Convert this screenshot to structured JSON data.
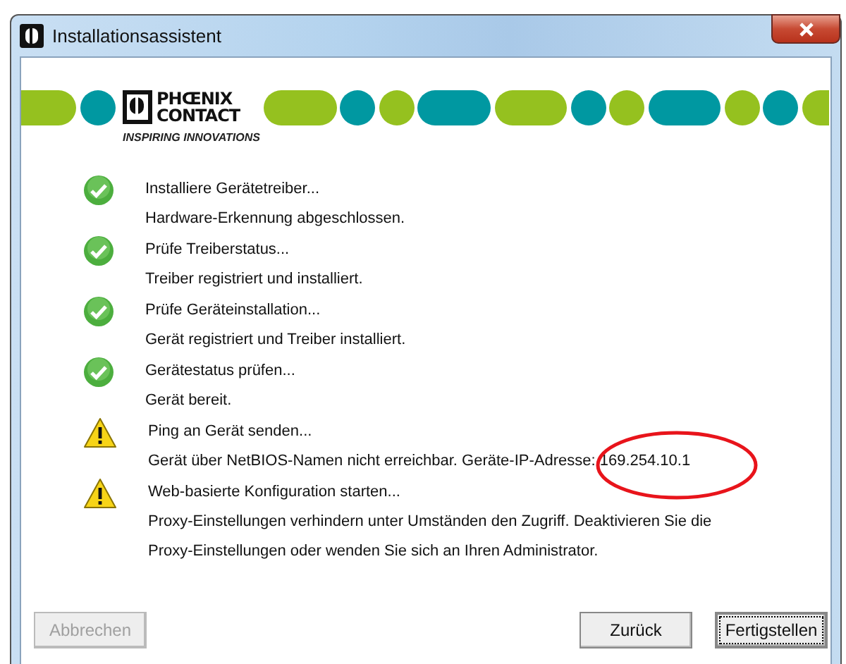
{
  "window": {
    "title": "Installationsassistent"
  },
  "logo": {
    "line_1": "PHŒNIX",
    "line_2": "CONTACT",
    "tagline": "INSPIRING INNOVATIONS"
  },
  "steps": [
    {
      "kind": "success",
      "title": "Installiere Gerätetreiber...",
      "details": [
        "Hardware-Erkennung abgeschlossen."
      ]
    },
    {
      "kind": "success",
      "title": "Prüfe Treiberstatus...",
      "details": [
        "Treiber registriert und installiert."
      ]
    },
    {
      "kind": "success",
      "title": "Prüfe Geräteinstallation...",
      "details": [
        "Gerät registriert und Treiber installiert."
      ]
    },
    {
      "kind": "success",
      "title": "Gerätestatus prüfen...",
      "details": [
        "Gerät bereit."
      ]
    },
    {
      "kind": "warning",
      "title": "Ping an Gerät senden...",
      "details": [
        "Gerät über NetBIOS-Namen nicht erreichbar. Geräte-IP-Adresse: 169.254.10.1"
      ]
    },
    {
      "kind": "warning",
      "title": "Web-basierte Konfiguration starten...",
      "details": [
        "Proxy-Einstellungen verhindern unter Umständen den Zugriff. Deaktivieren Sie die",
        "Proxy-Einstellungen oder wenden Sie sich an Ihren Administrator."
      ]
    }
  ],
  "buttons": [
    {
      "label": "Abbrechen",
      "disabled": true,
      "focused": false
    },
    {
      "label": "Zurück",
      "disabled": false,
      "focused": false
    },
    {
      "label": "Fertigstellen",
      "disabled": false,
      "focused": true
    }
  ]
}
